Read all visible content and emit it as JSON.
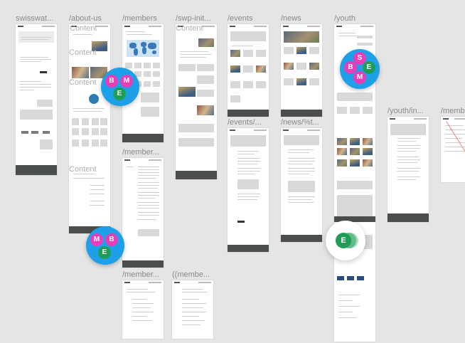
{
  "frames": [
    {
      "label": "swisswat..."
    },
    {
      "label": "/about-us"
    },
    {
      "label": "/members"
    },
    {
      "label": "/swp-init..."
    },
    {
      "label": "/events"
    },
    {
      "label": "/news"
    },
    {
      "label": "/youth"
    },
    {
      "label": "/member..."
    },
    {
      "label": "/events/..."
    },
    {
      "label": "/news/%t..."
    },
    {
      "label": "/youth/in..."
    },
    {
      "label": "/memb"
    },
    {
      "label": "/member..."
    },
    {
      "label": "((membe..."
    }
  ],
  "content_overlays": [
    "Content",
    "Content",
    "Content",
    "Content",
    "Content"
  ],
  "collaborators": {
    "cluster_about": [
      "B",
      "M",
      "E"
    ],
    "cluster_youth": [
      "S",
      "B",
      "E",
      "M"
    ],
    "cluster_about_bottom": [
      "M",
      "B",
      "E"
    ],
    "single_youth": [
      "E"
    ]
  },
  "colors": {
    "canvas": "#e5e5e5",
    "cluster_bg": "#1ea0e8",
    "avatar_magenta": "#e83cba",
    "avatar_green": "#1f9d55",
    "footer": "#4a4e4a"
  }
}
